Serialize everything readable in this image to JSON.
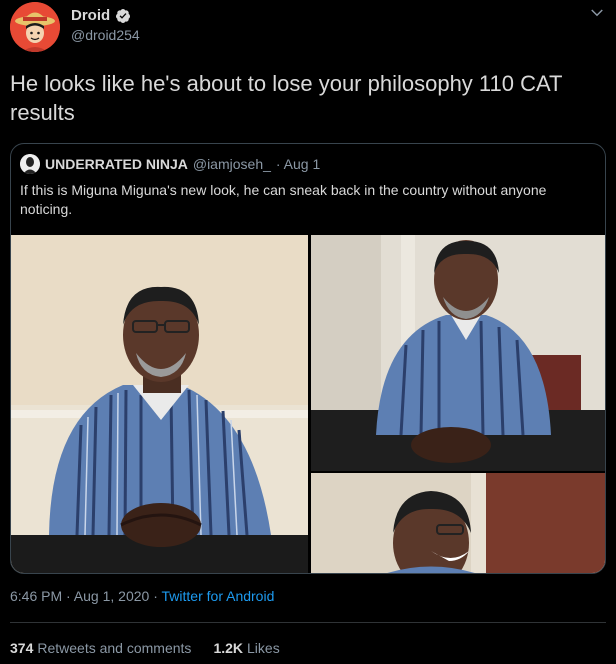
{
  "tweet": {
    "display_name": "Droid",
    "handle": "@droid254",
    "text": "He looks like he's about to lose your philosophy 110 CAT results",
    "timestamp": "6:46 PM · Aug 1, 2020",
    "separator": " · ",
    "source": "Twitter for Android"
  },
  "quote": {
    "display_name": "UNDERRATED NINJA",
    "handle": "@iamjoseh_",
    "date": "· Aug 1",
    "text": "If this is Miguna Miguna's new look, he can sneak back in the country without anyone noticing."
  },
  "stats": {
    "retweets_count": "374",
    "retweets_label": "Retweets and comments",
    "likes_count": "1.2K",
    "likes_label": "Likes"
  },
  "colors": {
    "background": "#000000",
    "text": "#d9d9d9",
    "secondary": "#8b98a5",
    "link": "#1d9bf0",
    "border": "#38444d",
    "avatar": "#e84a35"
  },
  "icons": [
    "avatar-luffy",
    "verified-icon",
    "chevron-down-icon"
  ]
}
